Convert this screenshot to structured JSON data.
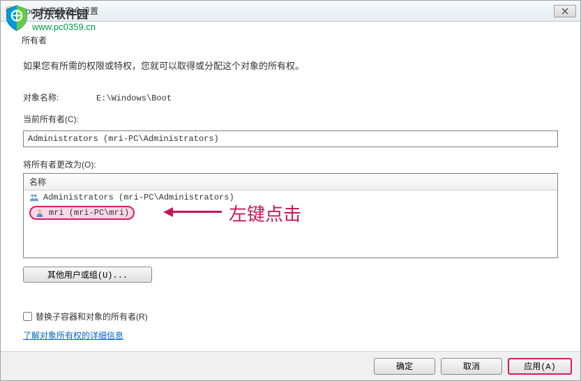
{
  "window": {
    "title": "Boot 的高级安全设置",
    "close_tooltip": "关闭"
  },
  "tabs": {
    "owner_label": "所有者"
  },
  "info_text": "如果您有所需的权限或特权，您就可以取得或分配这个对象的所有权。",
  "object_name": {
    "label": "对象名称:",
    "value": "E:\\Windows\\Boot"
  },
  "current_owner": {
    "label": "当前所有者(C):",
    "value": "Administrators (mri-PC\\Administrators)"
  },
  "change_owner": {
    "label": "将所有者更改为(O):",
    "column_header": "名称",
    "items": [
      {
        "icon": "group",
        "text": "Administrators (mri-PC\\Administrators)"
      },
      {
        "icon": "user",
        "text": "mri (mri-PC\\mri)"
      }
    ]
  },
  "annotation": {
    "text": "左键点击"
  },
  "other_users_button": "其他用户或组(U)...",
  "replace_checkbox": {
    "label": "替换子容器和对象的所有者(R)",
    "checked": false
  },
  "learn_link": "了解对象所有权的详细信息",
  "buttons": {
    "ok": "确定",
    "cancel": "取消",
    "apply": "应用(A)"
  },
  "watermark": {
    "site_name": "河东软件园",
    "url": "www.pc0359.cn"
  }
}
